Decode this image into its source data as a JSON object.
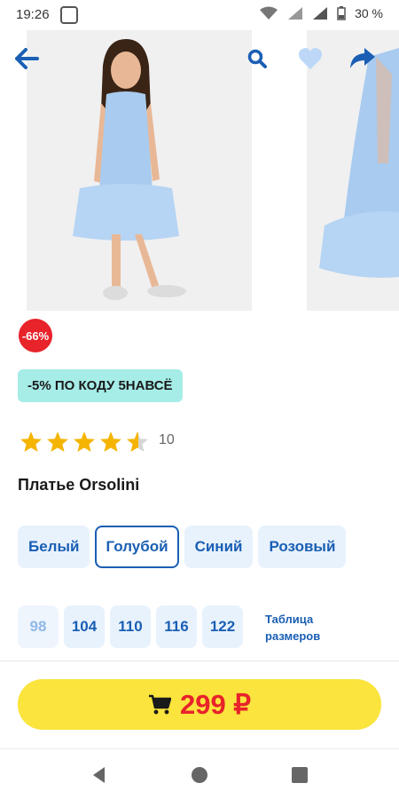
{
  "status_bar": {
    "time": "19:26",
    "battery": "30 %"
  },
  "product": {
    "discount_badge": "-66%",
    "promo": "-5% ПО КОДУ 5НАВСЁ",
    "rating_count": "10",
    "rating": 4.5,
    "title": "Платье Orsolini"
  },
  "colors": [
    {
      "label": "Белый",
      "selected": false
    },
    {
      "label": "Голубой",
      "selected": true
    },
    {
      "label": "Синий",
      "selected": false
    },
    {
      "label": "Розовый",
      "selected": false
    }
  ],
  "sizes": [
    {
      "label": "98",
      "available": false
    },
    {
      "label": "104",
      "available": true
    },
    {
      "label": "110",
      "available": true
    },
    {
      "label": "116",
      "available": true
    },
    {
      "label": "122",
      "available": true
    }
  ],
  "size_table": {
    "line1": "Таблица",
    "line2": "размеров"
  },
  "buy": {
    "price": "299 ₽"
  },
  "icons": {
    "back": "back-arrow-icon",
    "search": "search-icon",
    "favorite": "heart-icon",
    "share": "share-icon",
    "cart": "cart-icon"
  },
  "colors_theme": {
    "accent": "#1a5fb4",
    "price": "#e8232a",
    "buy_bg": "#fae43d",
    "promo_bg": "#a6ece7"
  }
}
